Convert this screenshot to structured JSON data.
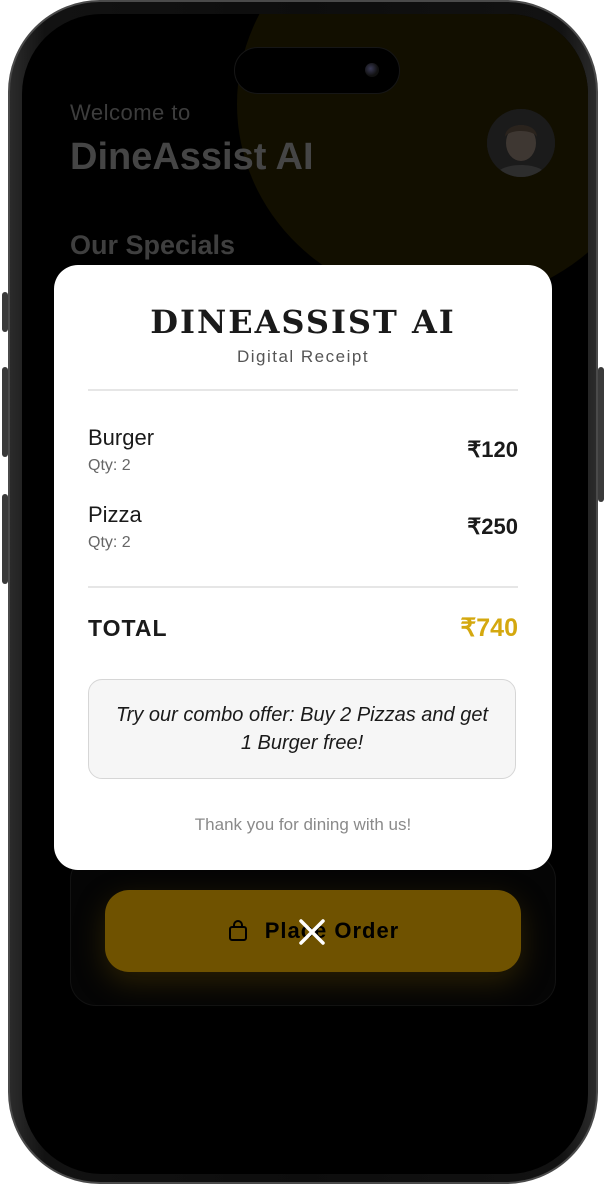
{
  "header": {
    "welcome_text": "Welcome to",
    "app_name": "DineAssist AI"
  },
  "sections": {
    "specials_title": "Our Specials"
  },
  "receipt": {
    "brand": "DINEASSIST AI",
    "subtitle": "Digital Receipt",
    "items": [
      {
        "name": "Burger",
        "qty": "Qty: 2",
        "price": "₹120"
      },
      {
        "name": "Pizza",
        "qty": "Qty: 2",
        "price": "₹250"
      }
    ],
    "total_label": "TOTAL",
    "total_value": "₹740",
    "offer_text": "Try our combo offer: Buy 2 Pizzas and get 1 Burger free!",
    "thanks_text": "Thank you for dining with us!"
  },
  "actions": {
    "place_order_label": "Place Order",
    "place_order_icon": "shopping-bag-icon",
    "close_icon": "close-icon"
  },
  "colors": {
    "accent_gold": "#d4a80f",
    "button_bg": "#6f5200",
    "modal_bg": "#ffffff",
    "screen_bg": "#000000"
  }
}
